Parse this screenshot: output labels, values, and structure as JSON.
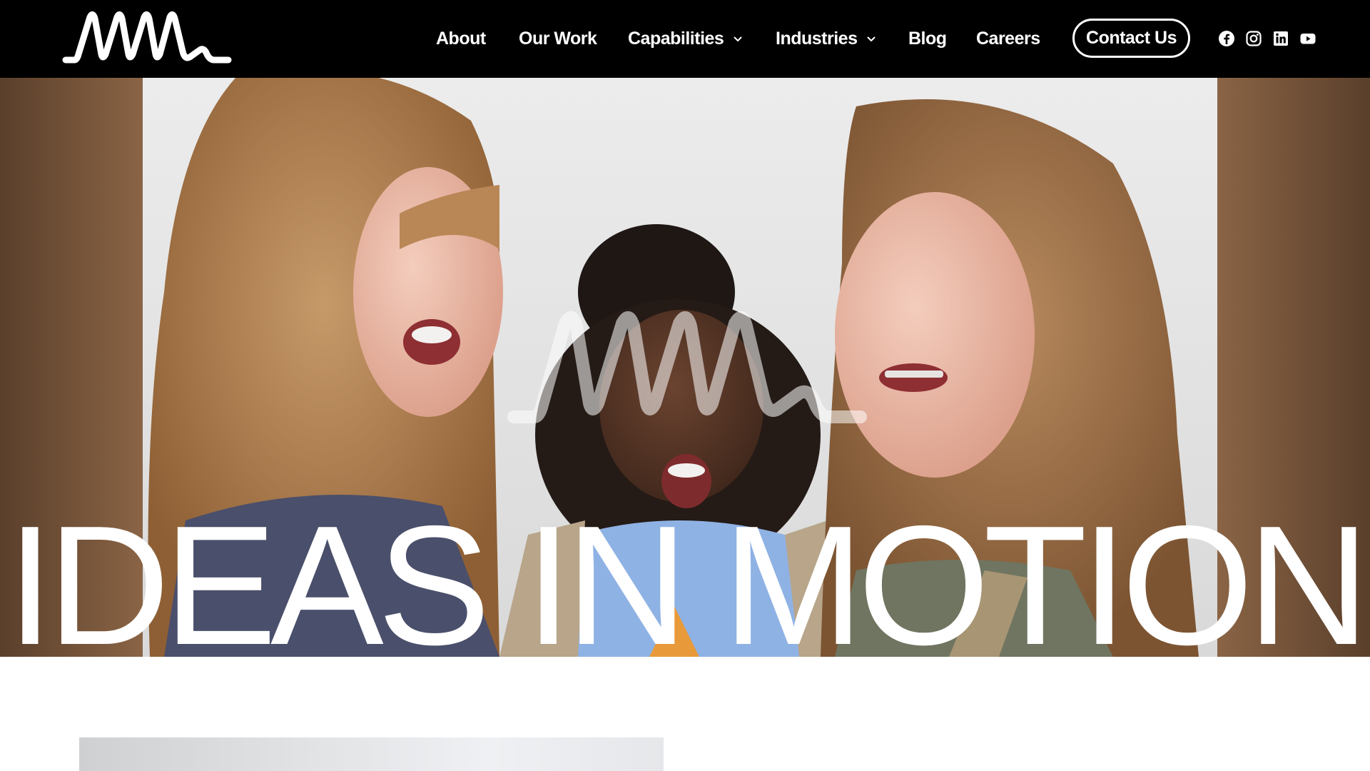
{
  "header": {
    "logo_alt": "MMM",
    "nav": [
      {
        "label": "About",
        "has_dropdown": false
      },
      {
        "label": "Our Work",
        "has_dropdown": false
      },
      {
        "label": "Capabilities",
        "has_dropdown": true
      },
      {
        "label": "Industries",
        "has_dropdown": true
      },
      {
        "label": "Blog",
        "has_dropdown": false
      },
      {
        "label": "Careers",
        "has_dropdown": false
      }
    ],
    "contact_label": "Contact Us",
    "social": [
      {
        "name": "facebook-icon"
      },
      {
        "name": "instagram-icon"
      },
      {
        "name": "linkedin-icon"
      },
      {
        "name": "youtube-icon"
      }
    ]
  },
  "hero": {
    "title": "IDEAS IN MOTION",
    "watermark": "MMM"
  },
  "colors": {
    "header_bg": "#000000",
    "header_text": "#ffffff",
    "hero_text": "#ffffff",
    "page_bg": "#ffffff"
  }
}
